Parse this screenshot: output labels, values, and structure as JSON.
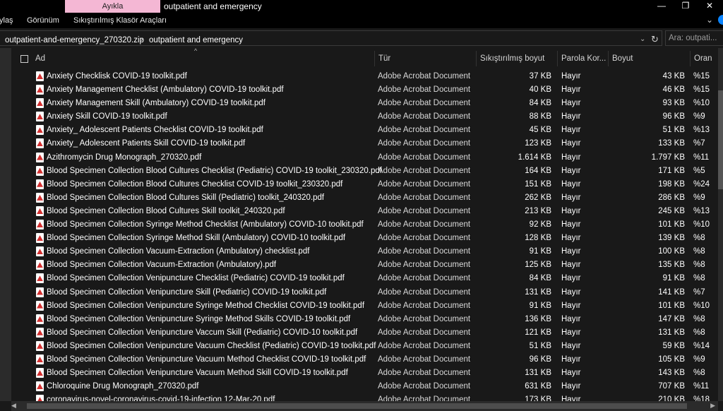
{
  "titlebar": {
    "context_tab": "Ayıkla",
    "title": "outpatient and emergency",
    "min_glyph": "—",
    "max_glyph": "❐",
    "close_glyph": "✕"
  },
  "ribbon": {
    "tabs": [
      "ylaş",
      "Görünüm",
      "Sıkıştırılmış Klasör Araçları"
    ],
    "expand_glyph": "⌄"
  },
  "address": {
    "crumbs": [
      "outpatient-and-emergency_270320.zip",
      "outpatient and emergency"
    ],
    "separator": "›",
    "dropdown_glyph": "⌄",
    "refresh_glyph": "↻"
  },
  "search": {
    "placeholder": "Ara: outpati..."
  },
  "columns": {
    "name": "Ad",
    "type": "Tür",
    "compressed_size": "Sıkıştırılmış boyut",
    "password": "Parola Kor...",
    "size": "Boyut",
    "ratio": "Oran"
  },
  "sort_glyph": "^",
  "files": [
    {
      "name": "Anxiety Checklisk COVID-19 toolkit.pdf",
      "type": "Adobe Acrobat Document",
      "csize": "37 KB",
      "pass": "Hayır",
      "size": "43 KB",
      "ratio": "%15"
    },
    {
      "name": "Anxiety Management Checklist (Ambulatory) COVID-19 toolkit.pdf",
      "type": "Adobe Acrobat Document",
      "csize": "40 KB",
      "pass": "Hayır",
      "size": "46 KB",
      "ratio": "%15"
    },
    {
      "name": "Anxiety Management Skill (Ambulatory) COVID-19 toolkit.pdf",
      "type": "Adobe Acrobat Document",
      "csize": "84 KB",
      "pass": "Hayır",
      "size": "93 KB",
      "ratio": "%10"
    },
    {
      "name": "Anxiety Skill COVID-19 toolkit.pdf",
      "type": "Adobe Acrobat Document",
      "csize": "88 KB",
      "pass": "Hayır",
      "size": "96 KB",
      "ratio": "%9"
    },
    {
      "name": "Anxiety_ Adolescent Patients Checklist COVID-19 toolkit.pdf",
      "type": "Adobe Acrobat Document",
      "csize": "45 KB",
      "pass": "Hayır",
      "size": "51 KB",
      "ratio": "%13"
    },
    {
      "name": "Anxiety_ Adolescent Patients Skill COVID-19 toolkit.pdf",
      "type": "Adobe Acrobat Document",
      "csize": "123 KB",
      "pass": "Hayır",
      "size": "133 KB",
      "ratio": "%7"
    },
    {
      "name": "Azithromycin Drug Monograph_270320.pdf",
      "type": "Adobe Acrobat Document",
      "csize": "1.614 KB",
      "pass": "Hayır",
      "size": "1.797 KB",
      "ratio": "%11"
    },
    {
      "name": "Blood Specimen Collection Blood Cultures Checklist (Pediatric) COVID-19 toolkit_230320.pdf",
      "type": "Adobe Acrobat Document",
      "csize": "164 KB",
      "pass": "Hayır",
      "size": "171 KB",
      "ratio": "%5"
    },
    {
      "name": "Blood Specimen Collection Blood Cultures Checklist COVID-19 toolkit_230320.pdf",
      "type": "Adobe Acrobat Document",
      "csize": "151 KB",
      "pass": "Hayır",
      "size": "198 KB",
      "ratio": "%24"
    },
    {
      "name": "Blood Specimen Collection Blood Cultures Skill (Pediatric) toolkit_240320.pdf",
      "type": "Adobe Acrobat Document",
      "csize": "262 KB",
      "pass": "Hayır",
      "size": "286 KB",
      "ratio": "%9"
    },
    {
      "name": "Blood Specimen Collection Blood Cultures Skill toolkit_240320.pdf",
      "type": "Adobe Acrobat Document",
      "csize": "213 KB",
      "pass": "Hayır",
      "size": "245 KB",
      "ratio": "%13"
    },
    {
      "name": "Blood Specimen Collection Syringe Method Checklist (Ambulatory) COVID-10 toolkit.pdf",
      "type": "Adobe Acrobat Document",
      "csize": "92 KB",
      "pass": "Hayır",
      "size": "101 KB",
      "ratio": "%10"
    },
    {
      "name": "Blood Specimen Collection Syringe Method Skill (Ambulatory) COVID-10 toolkit.pdf",
      "type": "Adobe Acrobat Document",
      "csize": "128 KB",
      "pass": "Hayır",
      "size": "139 KB",
      "ratio": "%8"
    },
    {
      "name": "Blood Specimen Collection Vacuum-Extraction (Ambulatory) checklist.pdf",
      "type": "Adobe Acrobat Document",
      "csize": "91 KB",
      "pass": "Hayır",
      "size": "100 KB",
      "ratio": "%8"
    },
    {
      "name": "Blood Specimen Collection Vacuum-Extraction (Ambulatory).pdf",
      "type": "Adobe Acrobat Document",
      "csize": "125 KB",
      "pass": "Hayır",
      "size": "135 KB",
      "ratio": "%8"
    },
    {
      "name": "Blood Specimen Collection Venipuncture Checklist (Pediatric) COVID-19 toolkit.pdf",
      "type": "Adobe Acrobat Document",
      "csize": "84 KB",
      "pass": "Hayır",
      "size": "91 KB",
      "ratio": "%8"
    },
    {
      "name": "Blood Specimen Collection Venipuncture Skill (Pediatric) COVID-19 toolkit.pdf",
      "type": "Adobe Acrobat Document",
      "csize": "131 KB",
      "pass": "Hayır",
      "size": "141 KB",
      "ratio": "%7"
    },
    {
      "name": "Blood Specimen Collection Venipuncture Syringe Method Checklist COVID-19 toolkit.pdf",
      "type": "Adobe Acrobat Document",
      "csize": "91 KB",
      "pass": "Hayır",
      "size": "101 KB",
      "ratio": "%10"
    },
    {
      "name": "Blood Specimen Collection Venipuncture Syringe Method Skills COVID-19 toolkit.pdf",
      "type": "Adobe Acrobat Document",
      "csize": "136 KB",
      "pass": "Hayır",
      "size": "147 KB",
      "ratio": "%8"
    },
    {
      "name": "Blood Specimen Collection Venipuncture Vaccum Skill (Pediatric) COVID-10 toolkit.pdf",
      "type": "Adobe Acrobat Document",
      "csize": "121 KB",
      "pass": "Hayır",
      "size": "131 KB",
      "ratio": "%8"
    },
    {
      "name": "Blood Specimen Collection Venipuncture Vacuum Checklist (Pediatric) COVID-19 toolkit.pdf",
      "type": "Adobe Acrobat Document",
      "csize": "51 KB",
      "pass": "Hayır",
      "size": "59 KB",
      "ratio": "%14"
    },
    {
      "name": "Blood Specimen Collection Venipuncture Vacuum Method Checklist COVID-19 toolkit.pdf",
      "type": "Adobe Acrobat Document",
      "csize": "96 KB",
      "pass": "Hayır",
      "size": "105 KB",
      "ratio": "%9"
    },
    {
      "name": "Blood Specimen Collection Venipuncture Vacuum Method Skill COVID-19 toolkit.pdf",
      "type": "Adobe Acrobat Document",
      "csize": "131 KB",
      "pass": "Hayır",
      "size": "143 KB",
      "ratio": "%8"
    },
    {
      "name": "Chloroquine Drug Monograph_270320.pdf",
      "type": "Adobe Acrobat Document",
      "csize": "631 KB",
      "pass": "Hayır",
      "size": "707 KB",
      "ratio": "%11"
    },
    {
      "name": "coronavirus-novel-coronavirus-covid-19-infection 12-Mar-20.pdf",
      "type": "Adobe Acrobat Document",
      "csize": "173 KB",
      "pass": "Hayır",
      "size": "210 KB",
      "ratio": "%18"
    }
  ],
  "hscroll": {
    "left_glyph": "◀",
    "right_glyph": "▶"
  }
}
